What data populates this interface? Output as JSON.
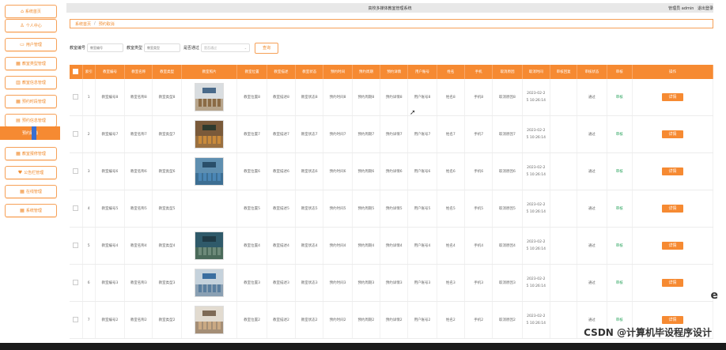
{
  "header": {
    "title": "高校多媒体教室管理系统",
    "admin_text": "管理员 admin",
    "logout": "退出登录"
  },
  "sidebar": {
    "items": [
      {
        "label": "系统首页",
        "icon": "home-icon",
        "glyph": "⌂"
      },
      {
        "label": "个人中心",
        "icon": "user-icon",
        "glyph": "♙"
      },
      {
        "label": "用户管理",
        "icon": "users-icon",
        "glyph": "▭"
      },
      {
        "label": "教室类型管理",
        "icon": "grid-icon",
        "glyph": "▦"
      },
      {
        "label": "教室信息管理",
        "icon": "building-icon",
        "glyph": "▥"
      },
      {
        "label": "预约时段管理",
        "icon": "grid-icon",
        "glyph": "▦"
      },
      {
        "label": "预约信息管理",
        "icon": "list-icon",
        "glyph": "▤"
      },
      {
        "label": "预约取消",
        "icon": "none",
        "glyph": ""
      },
      {
        "label": "教室报修管理",
        "icon": "grid-icon",
        "glyph": "▦"
      },
      {
        "label": "公告栏管理",
        "icon": "heart-icon",
        "glyph": "♥"
      },
      {
        "label": "在线管理",
        "icon": "grid-icon",
        "glyph": "▦"
      },
      {
        "label": "系统管理",
        "icon": "grid-icon",
        "glyph": "▦"
      }
    ],
    "active_index": 7
  },
  "breadcrumb": {
    "home": "系统首页",
    "sep": "/",
    "current": "预约取消"
  },
  "search": {
    "fields": [
      {
        "label": "教室编号",
        "placeholder": "教室编号"
      },
      {
        "label": "教室类型",
        "placeholder": "教室类型"
      }
    ],
    "select": {
      "label": "是否通过",
      "placeholder": "是否通过"
    },
    "button": "查询"
  },
  "table": {
    "headers": [
      "",
      "索引",
      "教室编号",
      "教室名称",
      "教室类型",
      "教室照片",
      "教室位置",
      "教室描述",
      "教室状态",
      "预约时间",
      "预约周期",
      "预约详情",
      "用户账号",
      "姓名",
      "手机",
      "取消原因",
      "取消时间",
      "审核回复",
      "审核状态",
      "审核",
      "操作"
    ],
    "rows": [
      {
        "idx": "1",
        "code": "教室编号8",
        "name": "教室名称8",
        "type": "教室类型8",
        "loc": "教室位置8",
        "desc": "教室描述8",
        "status": "教室状态8",
        "time": "预约时间8",
        "cycle": "预约周期8",
        "detail": "预约详情8",
        "account": "用户账号8",
        "uname": "姓名8",
        "phone": "手机8",
        "reason": "取消原因8",
        "date1": "2023-02-2",
        "date2": "5 10:26:14",
        "reply": "",
        "audit_status": "通过",
        "audit": "审核",
        "op": "详情",
        "photo": "a"
      },
      {
        "idx": "2",
        "code": "教室编号7",
        "name": "教室名称7",
        "type": "教室类型7",
        "loc": "教室位置7",
        "desc": "教室描述7",
        "status": "教室状态7",
        "time": "预约时间7",
        "cycle": "预约周期7",
        "detail": "预约详情7",
        "account": "用户账号7",
        "uname": "姓名7",
        "phone": "手机7",
        "reason": "取消原因7",
        "date1": "2023-02-2",
        "date2": "5 10:26:14",
        "reply": "",
        "audit_status": "通过",
        "audit": "审核",
        "op": "详情",
        "photo": "b"
      },
      {
        "idx": "3",
        "code": "教室编号6",
        "name": "教室名称6",
        "type": "教室类型6",
        "loc": "教室位置6",
        "desc": "教室描述6",
        "status": "教室状态6",
        "time": "预约时间6",
        "cycle": "预约周期6",
        "detail": "预约详情6",
        "account": "用户账号6",
        "uname": "姓名6",
        "phone": "手机6",
        "reason": "取消原因6",
        "date1": "2023-02-2",
        "date2": "5 10:26:14",
        "reply": "",
        "audit_status": "通过",
        "audit": "审核",
        "op": "详情",
        "photo": "c"
      },
      {
        "idx": "4",
        "code": "教室编号5",
        "name": "教室名称5",
        "type": "教室类型5",
        "loc": "教室位置5",
        "desc": "教室描述5",
        "status": "教室状态5",
        "time": "预约时间5",
        "cycle": "预约周期5",
        "detail": "预约详情5",
        "account": "用户账号5",
        "uname": "姓名5",
        "phone": "手机5",
        "reason": "取消原因5",
        "date1": "2023-02-2",
        "date2": "5 10:26:14",
        "reply": "",
        "audit_status": "通过",
        "audit": "审核",
        "op": "详情",
        "photo": "d"
      },
      {
        "idx": "5",
        "code": "教室编号4",
        "name": "教室名称4",
        "type": "教室类型4",
        "loc": "教室位置4",
        "desc": "教室描述4",
        "status": "教室状态4",
        "time": "预约时间4",
        "cycle": "预约周期4",
        "detail": "预约详情4",
        "account": "用户账号4",
        "uname": "姓名4",
        "phone": "手机4",
        "reason": "取消原因4",
        "date1": "2023-02-2",
        "date2": "5 10:26:14",
        "reply": "",
        "audit_status": "通过",
        "audit": "审核",
        "op": "详情",
        "photo": "e"
      },
      {
        "idx": "6",
        "code": "教室编号3",
        "name": "教室名称3",
        "type": "教室类型3",
        "loc": "教室位置3",
        "desc": "教室描述3",
        "status": "教室状态3",
        "time": "预约时间3",
        "cycle": "预约周期3",
        "detail": "预约详情3",
        "account": "用户账号3",
        "uname": "姓名3",
        "phone": "手机3",
        "reason": "取消原因3",
        "date1": "2023-02-2",
        "date2": "5 10:26:14",
        "reply": "",
        "audit_status": "通过",
        "audit": "审核",
        "op": "详情",
        "photo": "f"
      },
      {
        "idx": "7",
        "code": "教室编号2",
        "name": "教室名称2",
        "type": "教室类型2",
        "loc": "教室位置2",
        "desc": "教室描述2",
        "status": "教室状态2",
        "time": "预约时间2",
        "cycle": "预约周期2",
        "detail": "预约详情2",
        "account": "用户账号2",
        "uname": "姓名2",
        "phone": "手机2",
        "reason": "取消原因2",
        "date1": "2023-02-2",
        "date2": "5 10:26:14",
        "reply": "",
        "audit_status": "通过",
        "audit": "审核",
        "op": "详情",
        "photo": "g"
      }
    ]
  },
  "watermark": "CSDN @计算机毕设程序设计",
  "edge_glyph": "e",
  "colors": {
    "accent": "#f68a32",
    "audit_green": "#25a25a",
    "active_marker": "#3a6fd1"
  }
}
